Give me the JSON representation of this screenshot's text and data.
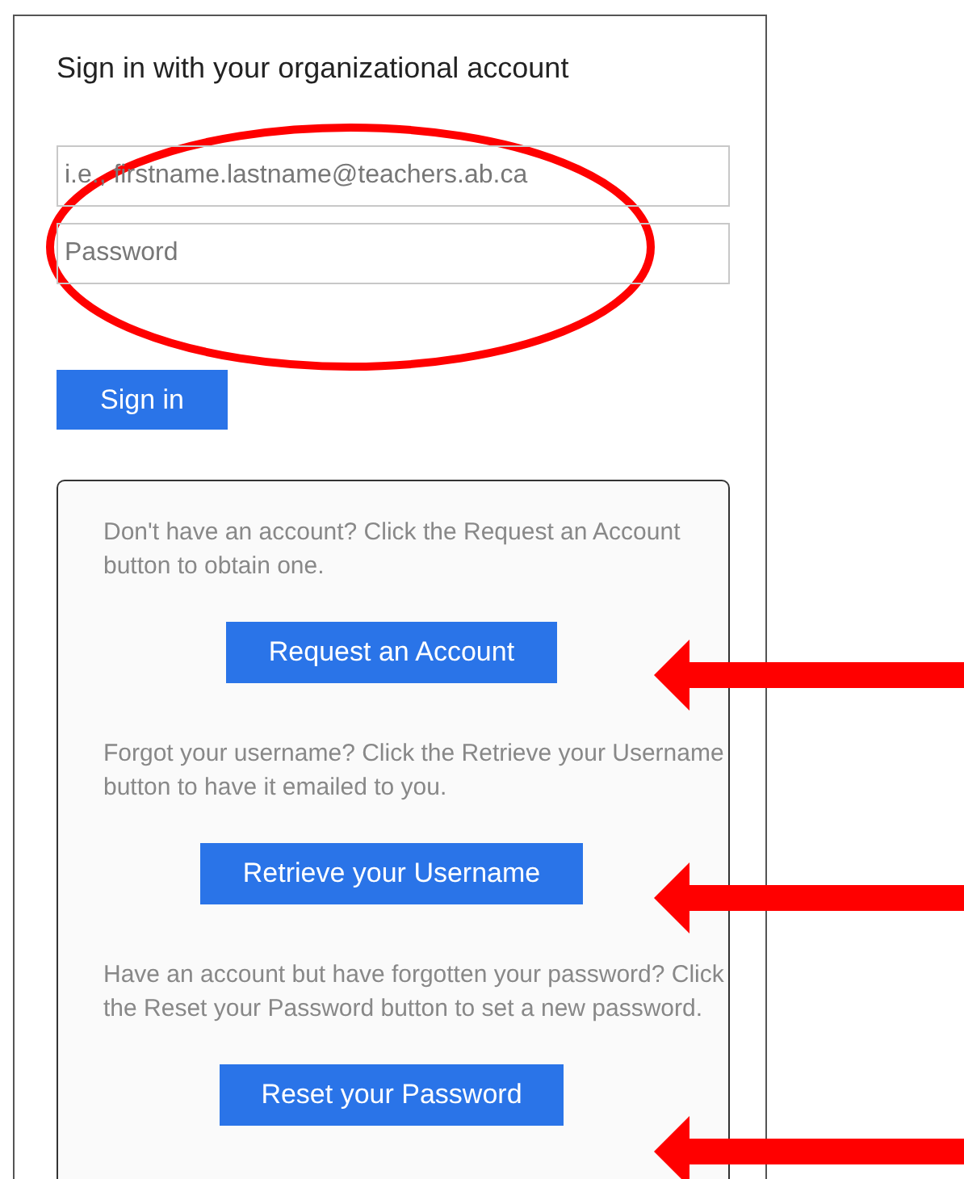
{
  "title": "Sign in with your organizational account",
  "fields": [
    {
      "placeholder": "i.e., firstname.lastname@teachers.ab.ca"
    },
    {
      "placeholder": "Password"
    }
  ],
  "sign_in_button": "Sign in",
  "help_sections": [
    {
      "text": "Don't have an account? Click the Request an Account button to obtain one.",
      "button": "Request an Account"
    },
    {
      "text": "Forgot your username? Click the Retrieve your Username button to have it emailed to you.",
      "button": "Retrieve your Username"
    },
    {
      "text": "Have an account but have forgotten your password? Click the Reset your Password button to set a new password.",
      "button": "Reset your Password"
    }
  ],
  "annotations": [
    {
      "kind": "ellipse"
    },
    {
      "kind": "arrow"
    },
    {
      "kind": "arrow"
    },
    {
      "kind": "arrow"
    }
  ]
}
